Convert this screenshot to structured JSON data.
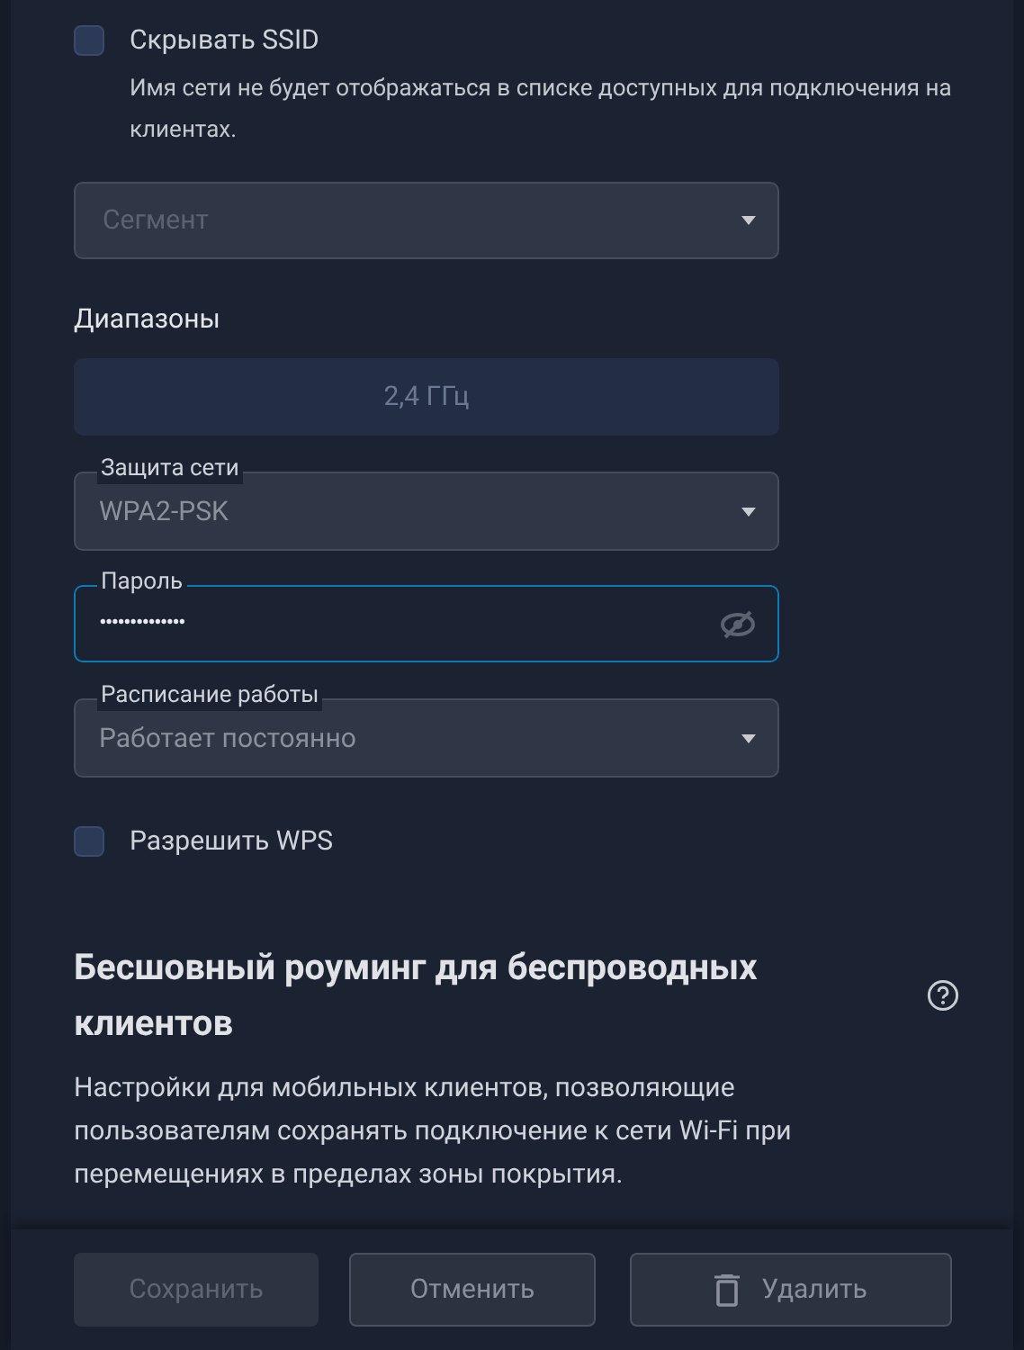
{
  "hide_ssid": {
    "label": "Скрывать SSID",
    "checked": false,
    "hint": "Имя сети не будет отображаться в списке доступных для подключения на клиентах."
  },
  "segment": {
    "placeholder": "Сегмент",
    "disabled": true
  },
  "bands": {
    "title": "Диапазоны",
    "items": [
      {
        "label": "2,4 ГГц",
        "selected": false
      }
    ]
  },
  "security": {
    "label": "Защита сети",
    "value": "WPA2-PSK"
  },
  "password": {
    "label": "Пароль",
    "value": "••••••••••••••",
    "focused": true
  },
  "schedule": {
    "label": "Расписание работы",
    "value": "Работает постоянно"
  },
  "wps": {
    "label": "Разрешить WPS",
    "checked": false
  },
  "roaming": {
    "title": "Бесшовный роуминг для беспроводных клиентов",
    "description": "Настройки для мобильных клиентов, позволяющие пользователям сохранять подключение к сети Wi-Fi при перемещениях в пределах зоны покрытия."
  },
  "buttons": [
    {
      "label": "Сохранить",
      "kind": "save",
      "disabled": true
    },
    {
      "label": "Отменить",
      "kind": "cancel",
      "disabled": false
    },
    {
      "label": "Удалить",
      "kind": "delete",
      "disabled": false
    }
  ]
}
